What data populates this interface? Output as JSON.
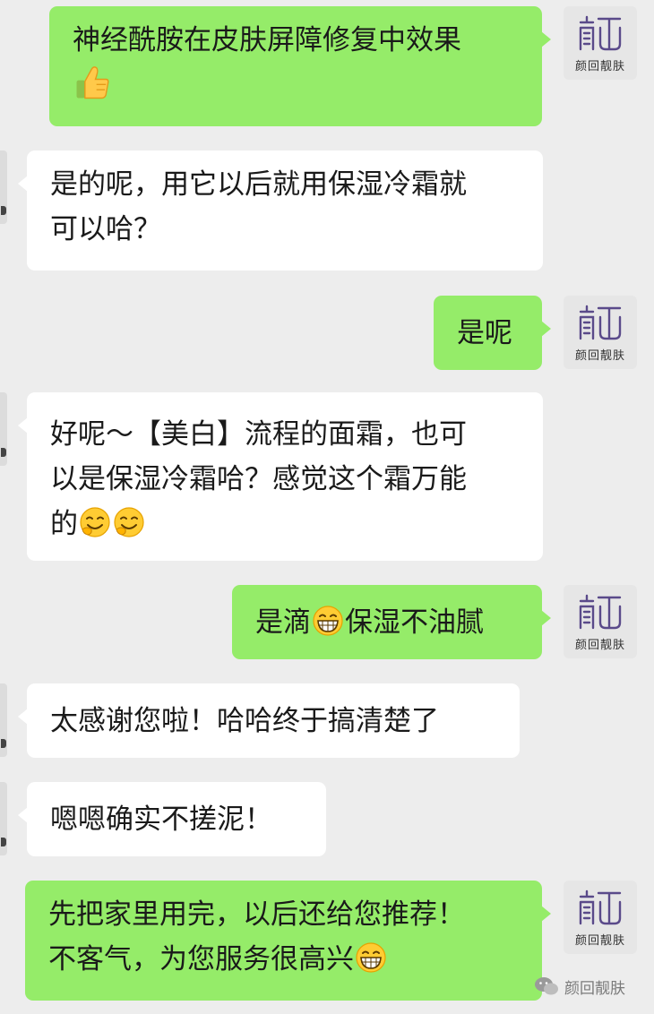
{
  "chat": {
    "sender_name": "颜回靓肤",
    "messages": [
      {
        "side": "mine",
        "text": "神经酰胺在皮肤屏障修复中效果",
        "emoji_after": "thumbs-up"
      },
      {
        "side": "theirs",
        "line1": "是的呢，用它以后就用保湿冷霜就",
        "line2": "可以哈？"
      },
      {
        "side": "mine",
        "text": "是呢"
      },
      {
        "side": "theirs",
        "line1": "好呢～【美白】流程的面霜，也可",
        "line2": "以是保湿冷霜哈？感觉这个霜万能",
        "line3": "的"
      },
      {
        "side": "mine",
        "text_before": "是滴",
        "text_after": "保湿不油腻"
      },
      {
        "side": "theirs",
        "text": "太感谢您啦！哈哈终于搞清楚了"
      },
      {
        "side": "theirs",
        "text": "嗯嗯确实不搓泥！"
      },
      {
        "side": "mine",
        "line1": "先把家里用完，以后还给您推荐！",
        "line2": "不客气，为您服务很高兴"
      }
    ]
  },
  "watermark": {
    "label": "颜回靓肤",
    "icon": "wechat-icon"
  },
  "colors": {
    "background": "#ededed",
    "mine_bubble": "#95ec69",
    "theirs_bubble": "#ffffff"
  },
  "icons": {
    "thumbs_up": "thumbs-up-emoji",
    "grin_sweat": "smirk-laugh-emoji",
    "grin": "grin-emoji"
  }
}
